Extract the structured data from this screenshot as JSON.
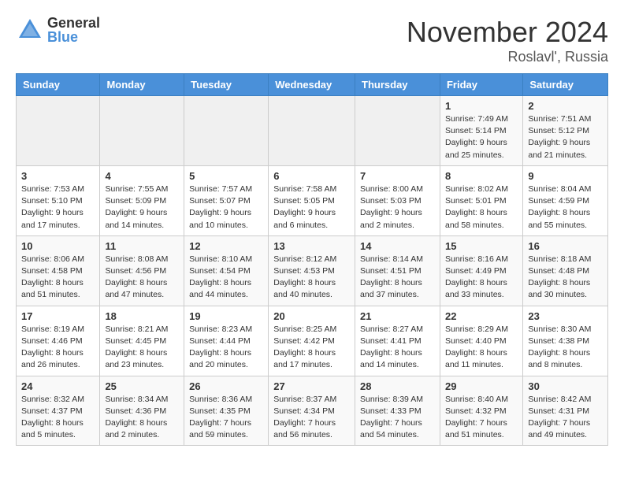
{
  "logo": {
    "general": "General",
    "blue": "Blue"
  },
  "title": "November 2024",
  "location": "Roslavl', Russia",
  "weekdays": [
    "Sunday",
    "Monday",
    "Tuesday",
    "Wednesday",
    "Thursday",
    "Friday",
    "Saturday"
  ],
  "weeks": [
    [
      {
        "day": "",
        "info": ""
      },
      {
        "day": "",
        "info": ""
      },
      {
        "day": "",
        "info": ""
      },
      {
        "day": "",
        "info": ""
      },
      {
        "day": "",
        "info": ""
      },
      {
        "day": "1",
        "info": "Sunrise: 7:49 AM\nSunset: 5:14 PM\nDaylight: 9 hours\nand 25 minutes."
      },
      {
        "day": "2",
        "info": "Sunrise: 7:51 AM\nSunset: 5:12 PM\nDaylight: 9 hours\nand 21 minutes."
      }
    ],
    [
      {
        "day": "3",
        "info": "Sunrise: 7:53 AM\nSunset: 5:10 PM\nDaylight: 9 hours\nand 17 minutes."
      },
      {
        "day": "4",
        "info": "Sunrise: 7:55 AM\nSunset: 5:09 PM\nDaylight: 9 hours\nand 14 minutes."
      },
      {
        "day": "5",
        "info": "Sunrise: 7:57 AM\nSunset: 5:07 PM\nDaylight: 9 hours\nand 10 minutes."
      },
      {
        "day": "6",
        "info": "Sunrise: 7:58 AM\nSunset: 5:05 PM\nDaylight: 9 hours\nand 6 minutes."
      },
      {
        "day": "7",
        "info": "Sunrise: 8:00 AM\nSunset: 5:03 PM\nDaylight: 9 hours\nand 2 minutes."
      },
      {
        "day": "8",
        "info": "Sunrise: 8:02 AM\nSunset: 5:01 PM\nDaylight: 8 hours\nand 58 minutes."
      },
      {
        "day": "9",
        "info": "Sunrise: 8:04 AM\nSunset: 4:59 PM\nDaylight: 8 hours\nand 55 minutes."
      }
    ],
    [
      {
        "day": "10",
        "info": "Sunrise: 8:06 AM\nSunset: 4:58 PM\nDaylight: 8 hours\nand 51 minutes."
      },
      {
        "day": "11",
        "info": "Sunrise: 8:08 AM\nSunset: 4:56 PM\nDaylight: 8 hours\nand 47 minutes."
      },
      {
        "day": "12",
        "info": "Sunrise: 8:10 AM\nSunset: 4:54 PM\nDaylight: 8 hours\nand 44 minutes."
      },
      {
        "day": "13",
        "info": "Sunrise: 8:12 AM\nSunset: 4:53 PM\nDaylight: 8 hours\nand 40 minutes."
      },
      {
        "day": "14",
        "info": "Sunrise: 8:14 AM\nSunset: 4:51 PM\nDaylight: 8 hours\nand 37 minutes."
      },
      {
        "day": "15",
        "info": "Sunrise: 8:16 AM\nSunset: 4:49 PM\nDaylight: 8 hours\nand 33 minutes."
      },
      {
        "day": "16",
        "info": "Sunrise: 8:18 AM\nSunset: 4:48 PM\nDaylight: 8 hours\nand 30 minutes."
      }
    ],
    [
      {
        "day": "17",
        "info": "Sunrise: 8:19 AM\nSunset: 4:46 PM\nDaylight: 8 hours\nand 26 minutes."
      },
      {
        "day": "18",
        "info": "Sunrise: 8:21 AM\nSunset: 4:45 PM\nDaylight: 8 hours\nand 23 minutes."
      },
      {
        "day": "19",
        "info": "Sunrise: 8:23 AM\nSunset: 4:44 PM\nDaylight: 8 hours\nand 20 minutes."
      },
      {
        "day": "20",
        "info": "Sunrise: 8:25 AM\nSunset: 4:42 PM\nDaylight: 8 hours\nand 17 minutes."
      },
      {
        "day": "21",
        "info": "Sunrise: 8:27 AM\nSunset: 4:41 PM\nDaylight: 8 hours\nand 14 minutes."
      },
      {
        "day": "22",
        "info": "Sunrise: 8:29 AM\nSunset: 4:40 PM\nDaylight: 8 hours\nand 11 minutes."
      },
      {
        "day": "23",
        "info": "Sunrise: 8:30 AM\nSunset: 4:38 PM\nDaylight: 8 hours\nand 8 minutes."
      }
    ],
    [
      {
        "day": "24",
        "info": "Sunrise: 8:32 AM\nSunset: 4:37 PM\nDaylight: 8 hours\nand 5 minutes."
      },
      {
        "day": "25",
        "info": "Sunrise: 8:34 AM\nSunset: 4:36 PM\nDaylight: 8 hours\nand 2 minutes."
      },
      {
        "day": "26",
        "info": "Sunrise: 8:36 AM\nSunset: 4:35 PM\nDaylight: 7 hours\nand 59 minutes."
      },
      {
        "day": "27",
        "info": "Sunrise: 8:37 AM\nSunset: 4:34 PM\nDaylight: 7 hours\nand 56 minutes."
      },
      {
        "day": "28",
        "info": "Sunrise: 8:39 AM\nSunset: 4:33 PM\nDaylight: 7 hours\nand 54 minutes."
      },
      {
        "day": "29",
        "info": "Sunrise: 8:40 AM\nSunset: 4:32 PM\nDaylight: 7 hours\nand 51 minutes."
      },
      {
        "day": "30",
        "info": "Sunrise: 8:42 AM\nSunset: 4:31 PM\nDaylight: 7 hours\nand 49 minutes."
      }
    ]
  ]
}
